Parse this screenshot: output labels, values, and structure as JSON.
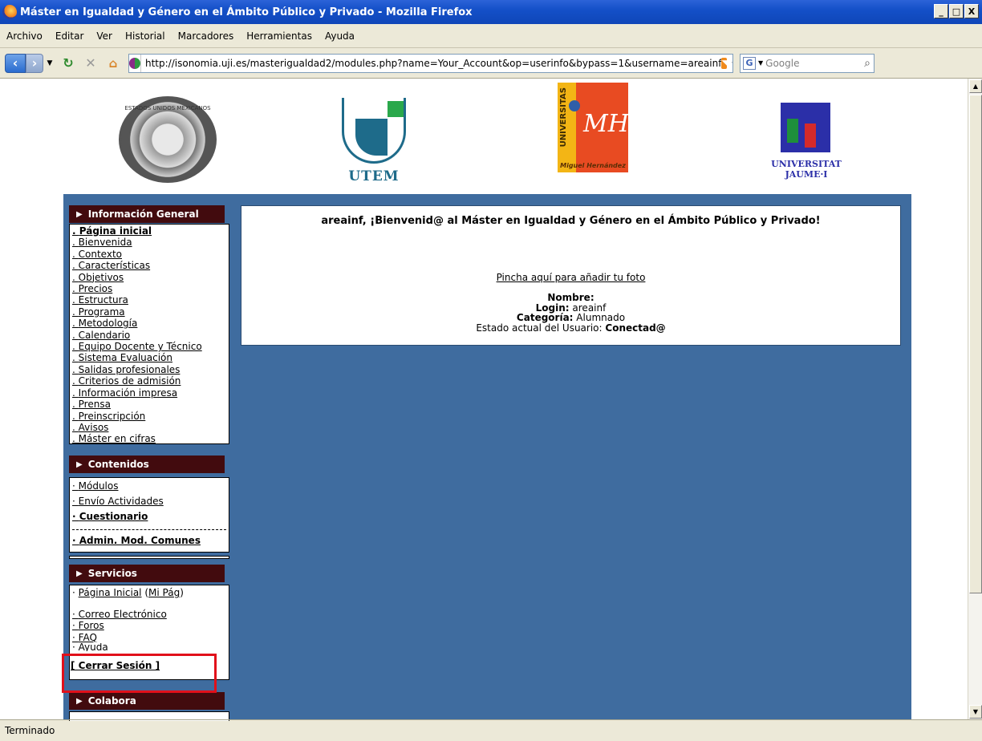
{
  "window": {
    "title": "Máster en Igualdad y Género en el Ámbito Público y Privado - Mozilla Firefox",
    "buttons": [
      "_",
      "□",
      "X"
    ]
  },
  "menubar": [
    "Archivo",
    "Editar",
    "Ver",
    "Historial",
    "Marcadores",
    "Herramientas",
    "Ayuda"
  ],
  "navbar": {
    "url": "http://isonomia.uji.es/masterigualdad2/modules.php?name=Your_Account&op=userinfo&bypass=1&username=areainf",
    "search_placeholder": "Google"
  },
  "logos": {
    "seal_text": "ESTADOS UNIDOS MEXICANOS",
    "utem": "UTEM",
    "umh_vertical": "UNIVERSITAS",
    "umh_mark": "MH",
    "umh_name": "Miguel Hernández",
    "uji_line1": "UNIVERSITAT",
    "uji_line2": "JAUME·I"
  },
  "sidebar": {
    "info_general": {
      "title": "Información General",
      "items": [
        "Página inicial",
        "Bienvenida",
        "Contexto",
        "Características",
        "Objetivos",
        "Precios",
        "Estructura",
        "Programa",
        "Metodología",
        "Calendario",
        "Equipo Docente y Técnico",
        "Sistema Evaluación",
        "Salidas profesionales",
        "Criterios de admisión",
        "Información impresa",
        "Prensa",
        "Preinscripción",
        "Avisos",
        "Máster en cifras"
      ]
    },
    "contenidos": {
      "title": "Contenidos",
      "items": [
        "Módulos",
        "Envío Actividades",
        "Cuestionario"
      ],
      "admin": "Admin. Mod. Comunes"
    },
    "servicios": {
      "title": "Servicios",
      "home": "Página Inicial",
      "my_page": "Mi Pág",
      "items": [
        "Correo Electrónico",
        "Foros",
        "FAQ",
        "Ayuda"
      ],
      "logout": "[ Cerrar Sesión ]"
    },
    "colabora": {
      "title": "Colabora"
    }
  },
  "panel": {
    "welcome": "areainf, ¡Bienvenid@ al Máster en Igualdad y Género en el Ámbito Público y Privado!",
    "photo_link": "Pincha aquí para añadir tu foto",
    "nombre_label": "Nombre:",
    "login_label": "Login:",
    "login_value": "areainf",
    "categoria_label": "Categoría:",
    "categoria_value": "Alumnado",
    "estado_label": "Estado actual del Usuario:",
    "estado_value": "Conectad@"
  },
  "status": "Terminado"
}
